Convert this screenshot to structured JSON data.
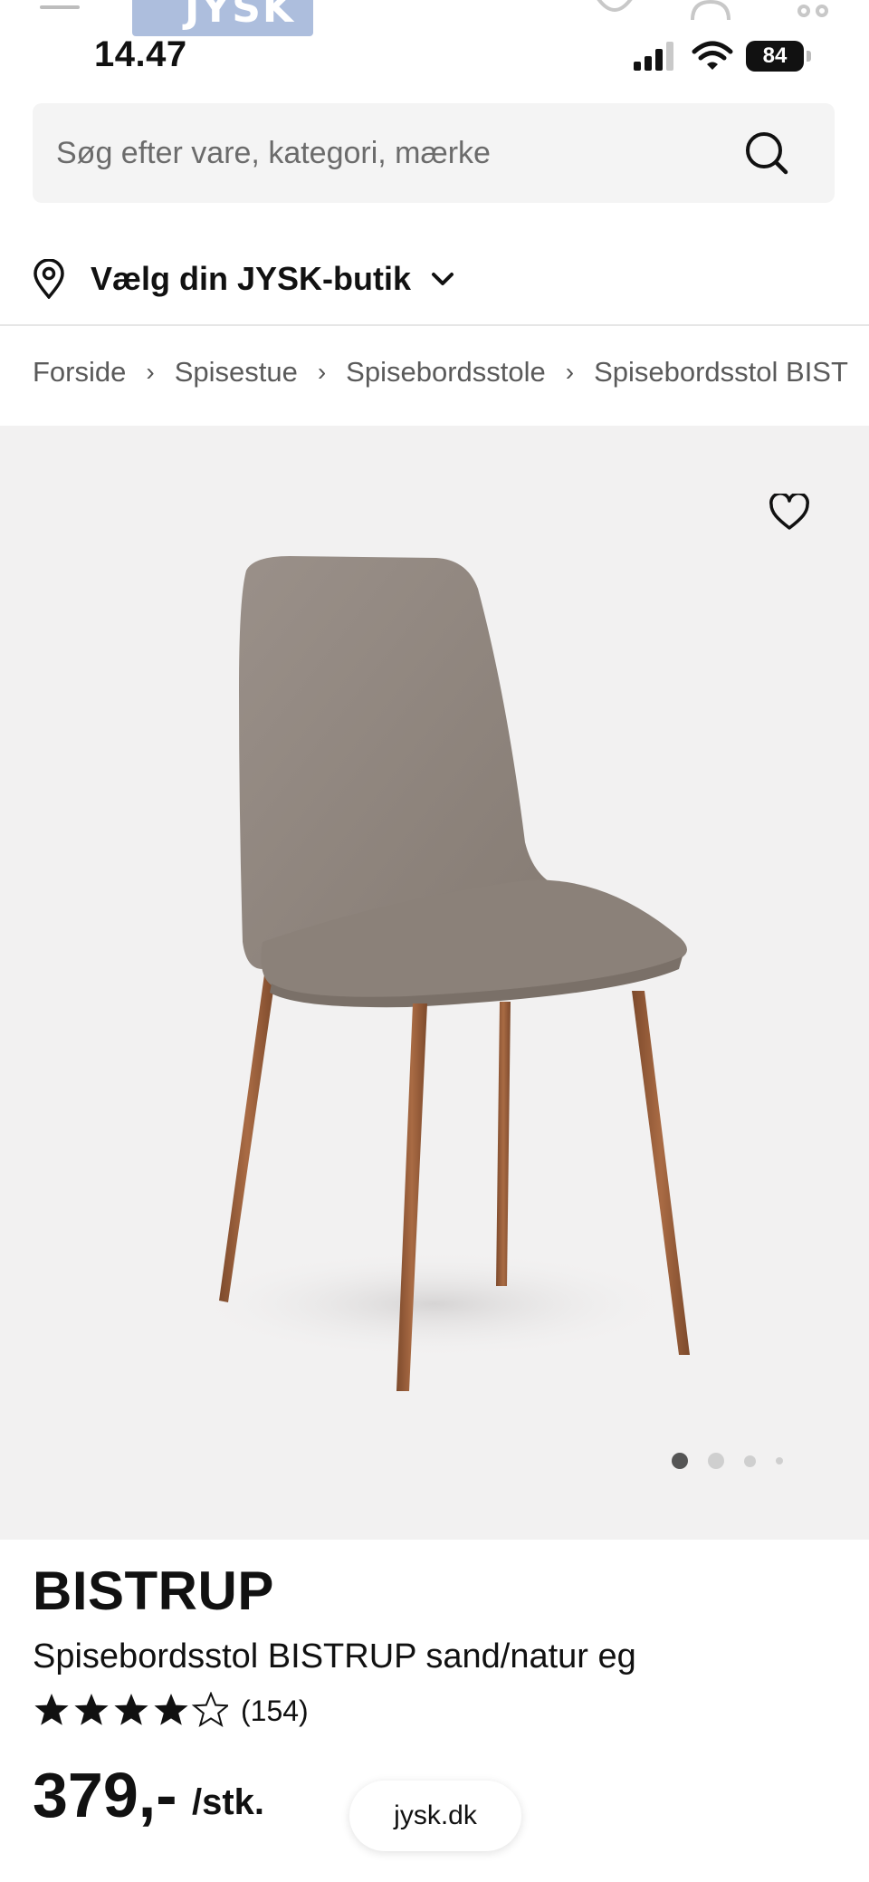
{
  "header": {
    "logo_text": "JYSK"
  },
  "status_bar": {
    "time": "14.47",
    "battery": "84"
  },
  "search": {
    "placeholder": "Søg efter vare, kategori, mærke"
  },
  "store": {
    "label": "Vælg din JYSK-butik"
  },
  "breadcrumb": [
    "Forside",
    "Spisestue",
    "Spisebordsstole",
    "Spisebordsstol BIST"
  ],
  "gallery": {
    "total_images": 4,
    "active_index": 0
  },
  "product": {
    "brand": "BISTRUP",
    "name": "Spisebordsstol BISTRUP sand/natur eg",
    "rating": 4.5,
    "rating_max": 5,
    "review_count": "(154)",
    "price": "379,-",
    "unit": "/stk."
  },
  "browser": {
    "url": "jysk.dk"
  },
  "colors": {
    "text": "#111111",
    "muted": "#5a5a5a",
    "search_bg": "#f4f4f4",
    "hero_bg": "#f2f1f1",
    "seat_fabric": "#8f857d",
    "leg_wood": "#9a5e3a"
  }
}
